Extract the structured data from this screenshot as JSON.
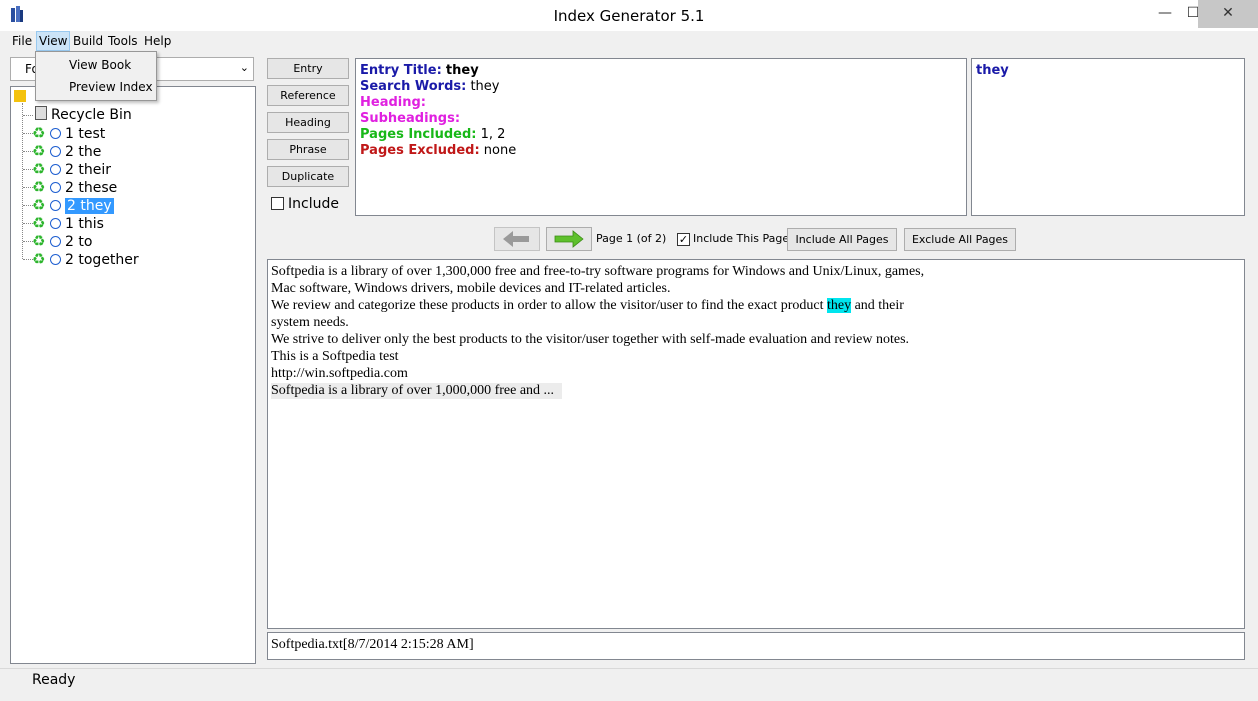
{
  "window": {
    "title": "Index Generator 5.1",
    "minimize": "—",
    "maximize": "☐",
    "close": "✕"
  },
  "menu": {
    "file": "File",
    "view": "View",
    "build": "Build",
    "tools": "Tools",
    "help": "Help"
  },
  "view_menu": {
    "items": [
      "View Book",
      "Preview Index"
    ]
  },
  "filter": {
    "value": "Fo"
  },
  "tree": {
    "recycle_bin": "Recycle Bin",
    "items": [
      {
        "count": "1",
        "word": "test"
      },
      {
        "count": "2",
        "word": "the"
      },
      {
        "count": "2",
        "word": "their"
      },
      {
        "count": "2",
        "word": "these"
      },
      {
        "count": "2",
        "word": "they"
      },
      {
        "count": "1",
        "word": "this"
      },
      {
        "count": "2",
        "word": "to"
      },
      {
        "count": "2",
        "word": "together"
      }
    ],
    "selected": "2 they"
  },
  "side_buttons": [
    "Entry",
    "Reference",
    "Heading",
    "Phrase",
    "Duplicate"
  ],
  "include_label": "Include",
  "entry": {
    "title_label": "Entry Title:",
    "title_value": "they",
    "search_label": "Search Words:",
    "search_value": "they",
    "heading_label": "Heading:",
    "subheadings_label": "Subheadings:",
    "pages_included_label": "Pages Included:",
    "pages_included_value": "1, 2",
    "pages_excluded_label": "Pages Excluded:",
    "pages_excluded_value": "none"
  },
  "preview": {
    "word": "they"
  },
  "nav": {
    "page_label": "Page 1 (of 2)",
    "include_page_label": "Include This Page",
    "include_all": "Include All Pages",
    "exclude_all": "Exclude All Pages"
  },
  "document": {
    "line1": "Softpedia is a library of over 1,300,000 free and free-to-try software programs for Windows and Unix/Linux, games,",
    "line2": "Mac software, Windows drivers, mobile devices and IT-related articles.",
    "line3_pre": "We review and categorize these products in order to allow the visitor/user to find the exact product ",
    "line3_hl": "they",
    "line3_post": " and their",
    "line4": "system needs.",
    "line5": "We strive to deliver only the best products to the visitor/user together with self-made evaluation and review notes.",
    "line6": "This is a Softpedia test",
    "line7": "http://win.softpedia.com",
    "line8": "Softpedia is a library of over 1,000,000 free and ..."
  },
  "file_info": "Softpedia.txt[8/7/2014 2:15:28 AM]",
  "status": "Ready",
  "colors": {
    "blue_label": "#1a1aa8",
    "heading_magenta": "#e020e0",
    "included_green": "#18b818",
    "excluded_red": "#c01818",
    "highlight": "#00e5ee",
    "selection": "#3399ff"
  }
}
